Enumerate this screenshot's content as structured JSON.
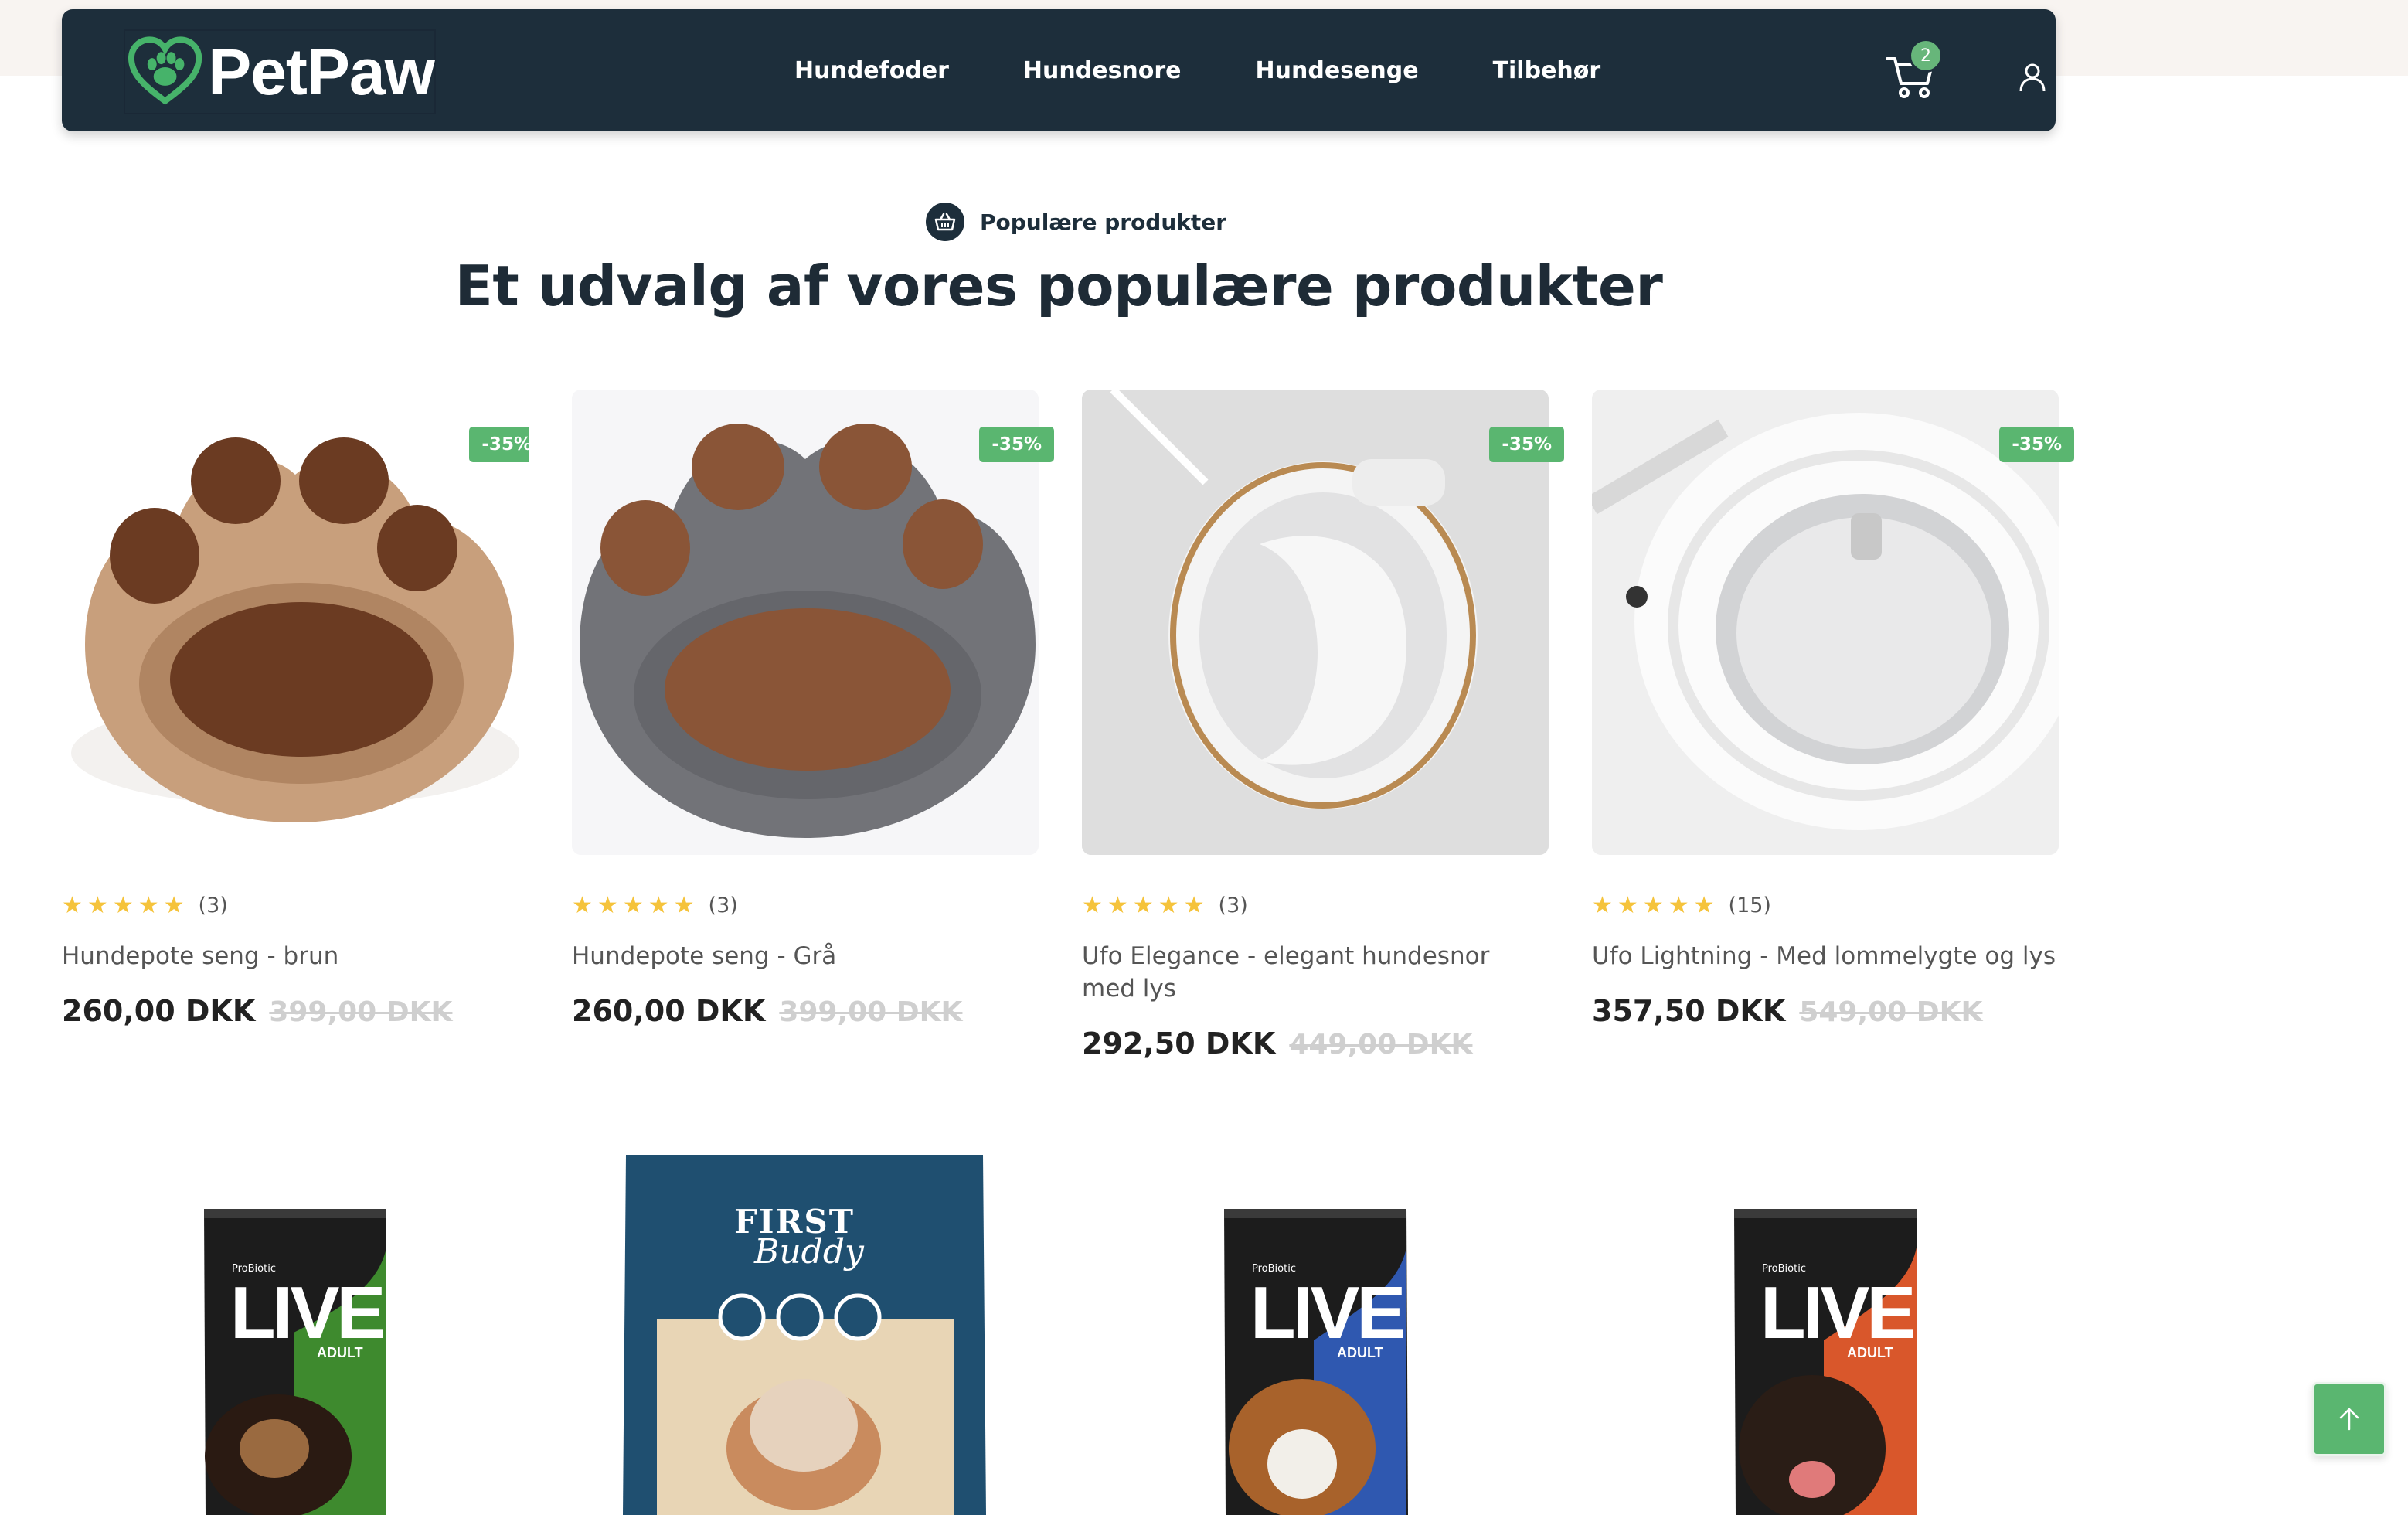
{
  "brand": {
    "name": "PetPaw"
  },
  "nav": {
    "items": [
      "Hundefoder",
      "Hundesnore",
      "Hundesenge",
      "Tilbehør"
    ]
  },
  "cart": {
    "count": "2"
  },
  "section": {
    "eyebrow": "Populære produkter",
    "title": "Et udvalg af vores populære produkter"
  },
  "products": [
    {
      "title": "Hundepote seng - brun",
      "rating_count": "(3)",
      "price": "260,00 DKK",
      "old_price": "399,00 DKK",
      "badge": "-35%",
      "stars": 5
    },
    {
      "title": "Hundepote seng - Grå",
      "rating_count": "(3)",
      "price": "260,00 DKK",
      "old_price": "399,00 DKK",
      "badge": "-35%",
      "stars": 5
    },
    {
      "title": "Ufo Elegance - elegant hundesnor med lys",
      "rating_count": "(3)",
      "price": "292,50 DKK",
      "old_price": "449,00 DKK",
      "badge": "-35%",
      "stars": 5
    },
    {
      "title": "Ufo Lightning - Med lommelygte og lys",
      "rating_count": "(15)",
      "price": "357,50 DKK",
      "old_price": "549,00 DKK",
      "badge": "-35%",
      "stars": 5
    }
  ],
  "second_row": [
    {
      "brand_line": "ProBiotic",
      "name": "LIVE",
      "sub": "ADULT",
      "accent": "#3e8a2e"
    },
    {
      "brand_line": "FIRST",
      "name": "Buddy",
      "sub": "",
      "accent": "#1f4f70"
    },
    {
      "brand_line": "ProBiotic",
      "name": "LIVE",
      "sub": "ADULT",
      "accent": "#2f58b0"
    },
    {
      "brand_line": "ProBiotic",
      "name": "LIVE",
      "sub": "ADULT",
      "accent": "#d9572b"
    }
  ],
  "colors": {
    "header": "#1d2e3b",
    "accent_green": "#5ab670",
    "star": "#f5c33b"
  }
}
